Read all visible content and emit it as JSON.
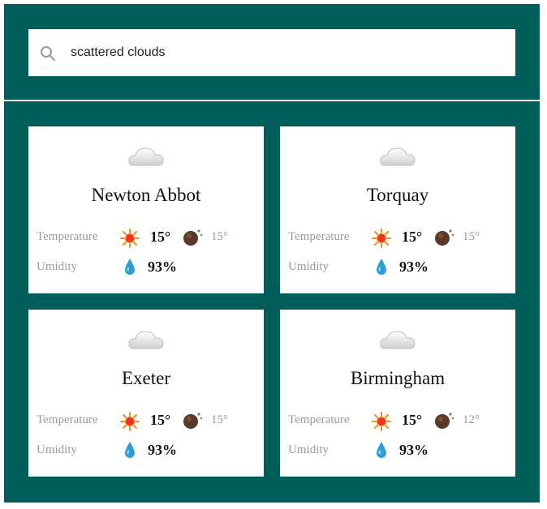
{
  "search": {
    "value": "scattered clouds",
    "icon": "search-icon"
  },
  "colors": {
    "background": "#005e5a",
    "card": "#ffffff",
    "muted_text": "#9a9a9a"
  },
  "labels": {
    "temperature": "Temperature",
    "humidity": "Umidity"
  },
  "cards": [
    {
      "city": "Newton Abbot",
      "condition_icon": "cloud-icon",
      "temp_day": "15°",
      "temp_night": "15°",
      "humidity": "93%"
    },
    {
      "city": "Torquay",
      "condition_icon": "cloud-icon",
      "temp_day": "15°",
      "temp_night": "15°",
      "humidity": "93%"
    },
    {
      "city": "Exeter",
      "condition_icon": "cloud-icon",
      "temp_day": "15°",
      "temp_night": "15°",
      "humidity": "93%"
    },
    {
      "city": "Birmingham",
      "condition_icon": "cloud-icon",
      "temp_day": "15°",
      "temp_night": "12°",
      "humidity": "93%"
    }
  ]
}
